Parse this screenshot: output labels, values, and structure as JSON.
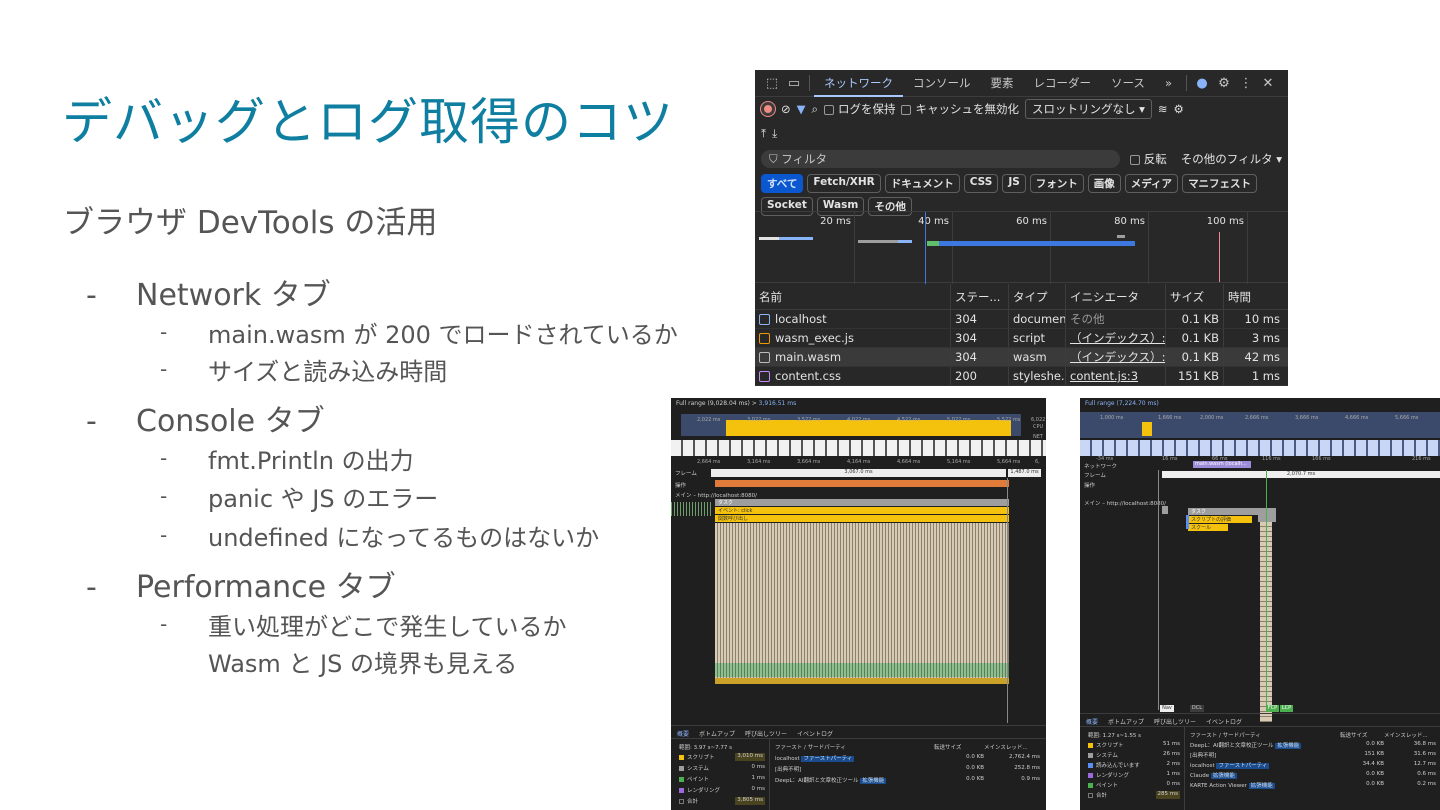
{
  "slide": {
    "title": "デバッグとログ取得のコツ",
    "subtitle": "ブラウザ DevTools の活用",
    "bullets": [
      {
        "label": "Network タブ",
        "items": [
          "main.wasm が 200 でロードされているか",
          "サイズと読み込み時間"
        ]
      },
      {
        "label": "Console タブ",
        "items": [
          "fmt.Println の出力",
          "panic や JS のエラー",
          "undefined になってるものはないか"
        ]
      },
      {
        "label": "Performance タブ",
        "items": [
          "重い処理がどこで発生しているか\nWasm と JS の境界も見える"
        ]
      }
    ],
    "dash": "-"
  },
  "network": {
    "tabs": [
      "ネットワーク",
      "コンソール",
      "要素",
      "レコーダー",
      "ソース"
    ],
    "more": "»",
    "close": "✕",
    "preserve_log": "ログを保持",
    "disable_cache": "キャッシュを無効化",
    "throttle": "スロットリングなし",
    "filter_placeholder": "フィルタ",
    "invert": "反転",
    "other_filters": "その他のフィルタ ▾",
    "chips": [
      "すべて",
      "Fetch/XHR",
      "ドキュメント",
      "CSS",
      "JS",
      "フォント",
      "画像",
      "メディア",
      "マニフェスト",
      "Socket",
      "Wasm",
      "その他"
    ],
    "timeline_labels": [
      "20 ms",
      "40 ms",
      "60 ms",
      "80 ms",
      "100 ms"
    ],
    "columns": [
      "名前",
      "ステー...",
      "タイプ",
      "イニシエータ",
      "サイズ",
      "時間"
    ],
    "rows": [
      {
        "name": "localhost",
        "status": "304",
        "type": "document",
        "initiator": "その他",
        "size": "0.1 KB",
        "time": "10 ms"
      },
      {
        "name": "wasm_exec.js",
        "status": "304",
        "type": "script",
        "initiator": "（インデックス）:9",
        "size": "0.1 KB",
        "time": "3 ms"
      },
      {
        "name": "main.wasm",
        "status": "304",
        "type": "wasm",
        "initiator": "（インデックス）:1",
        "size": "0.1 KB",
        "time": "42 ms"
      },
      {
        "name": "content.css",
        "status": "200",
        "type": "styleshe...",
        "initiator": "content.js:3",
        "size": "151 KB",
        "time": "1 ms"
      }
    ]
  },
  "perf_left": {
    "range_label": "Full range (9,028.04 ms)",
    "range_sel": "3,916.51 ms",
    "ruler": [
      "2,022 ms",
      "3,022 ms",
      "3,522 ms",
      "4,022 ms",
      "4,522 ms",
      "5,022 ms",
      "5,522 ms",
      "6,022"
    ],
    "ruler2": [
      "2,664 ms",
      "3,164 ms",
      "3,664 ms",
      "4,164 ms",
      "4,664 ms",
      "5,164 ms",
      "5,664 ms",
      "6,"
    ],
    "cpu": "CPU",
    "net": "NET",
    "frames_label": "フレーム",
    "frame_time": "3,067.0 ms",
    "frame_time2": "1,487.0 ms",
    "ops_label": "操作",
    "main_label": "メイン – http://localhost:8080/",
    "event_label": "イベント: click",
    "call_label": "関数呼び出し",
    "task_label": "タスク",
    "bottom_tabs": [
      "概要",
      "ボトムアップ",
      "呼び出しツリー",
      "イベントログ"
    ],
    "range": "範囲: 3.97 s~7.77 s",
    "summary": [
      {
        "label": "スクリプト",
        "value": "3,010 ms",
        "color": "#f4c20d"
      },
      {
        "label": "システム",
        "value": "0 ms",
        "color": "#9e9e9e"
      },
      {
        "label": "ペイント",
        "value": "1 ms",
        "color": "#4caf50"
      },
      {
        "label": "レンダリング",
        "value": "0 ms",
        "color": "#9c6ade"
      },
      {
        "label": "合計",
        "value": "3,805 ms",
        "color": "#1f1f1f"
      }
    ],
    "party_head": [
      "ファースト / サードパーティ",
      "転送サイズ",
      "メインスレッド..."
    ],
    "party_rows": [
      {
        "name": "localhost",
        "tag": "ファーストパーティ",
        "size": "0.0 KB",
        "time": "2,762.4 ms"
      },
      {
        "name": "[出典不明]",
        "tag": "",
        "size": "0.0 KB",
        "time": "252.8 ms"
      },
      {
        "name": "DeepL：AI翻訳と文章校正ツール",
        "tag": "拡張機能",
        "size": "0.0 KB",
        "time": "0.9 ms"
      }
    ]
  },
  "perf_right": {
    "range_label": "Full range (7,224.70 ms)",
    "ruler": [
      "1,000 ms",
      "1,666 ms",
      "2,000 ms",
      "2,666 ms",
      "3,666 ms",
      "4,666 ms",
      "5,666 ms"
    ],
    "ruler2": [
      "-34 ms",
      "16 ms",
      "66 ms",
      "116 ms",
      "166 ms",
      "216 ms"
    ],
    "network_label": "ネットワーク",
    "wasm_label": "main.wasm (localh...",
    "frames_label": "フレーム",
    "frame_time": "2,070.7 ms",
    "ops_label": "操作",
    "main_label": "メイン – http://localhost:8080/",
    "task_label": "タスク",
    "script_eval": "スクリプトの評価",
    "compile": "スクール",
    "markers": [
      "Nav",
      "DCL",
      "FCP",
      "LCP"
    ],
    "bottom_tabs": [
      "概要",
      "ボトムアップ",
      "呼び出しツリー",
      "イベントログ"
    ],
    "range": "範囲: 1.27 s~1.55 s",
    "summary": [
      {
        "label": "スクリプト",
        "value": "51 ms",
        "color": "#f4c20d"
      },
      {
        "label": "システム",
        "value": "26 ms",
        "color": "#9e9e9e"
      },
      {
        "label": "読み込んでいます",
        "value": "2 ms",
        "color": "#5c8df6"
      },
      {
        "label": "レンダリング",
        "value": "1 ms",
        "color": "#9c6ade"
      },
      {
        "label": "ペイント",
        "value": "0 ms",
        "color": "#4caf50"
      },
      {
        "label": "合計",
        "value": "285 ms",
        "color": "#1f1f1f"
      }
    ],
    "party_head": [
      "ファースト / サードパーティ",
      "転送サイズ",
      "メインスレッド..."
    ],
    "party_rows": [
      {
        "name": "DeepL：AI翻訳と文章校正ツール",
        "tag": "拡張機能",
        "size": "0.0 KB",
        "time": "36.8 ms"
      },
      {
        "name": "[出典不明]",
        "tag": "",
        "size": "151 KB",
        "time": "31.6 ms"
      },
      {
        "name": "localhost",
        "tag": "ファーストパーティ",
        "size": "34.4 KB",
        "time": "12.7 ms"
      },
      {
        "name": "Claude",
        "tag": "拡張機能",
        "size": "0.0 KB",
        "time": "0.6 ms"
      },
      {
        "name": "KARTE Action Viewer",
        "tag": "拡張機能",
        "size": "0.0 KB",
        "time": "0.2 ms"
      }
    ]
  },
  "colors": {
    "title": "#0e7ea1",
    "devtools_bg": "#282828",
    "accent": "#a8c7fa",
    "script": "#f4c20d"
  }
}
